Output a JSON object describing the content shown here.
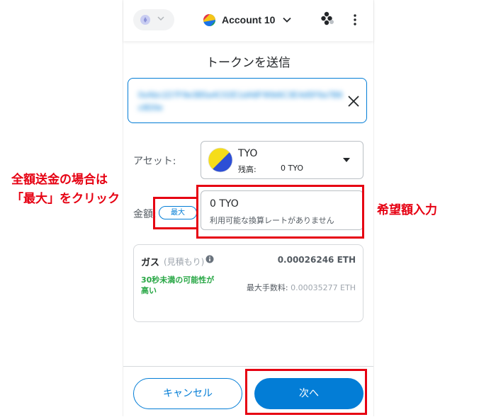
{
  "header": {
    "network_icon": "ethereum-icon",
    "account_name": "Account 10",
    "connection_icon": "connected-sites-icon",
    "menu_icon": "kebab-menu-icon"
  },
  "page": {
    "title": "トークンを送信"
  },
  "recipient": {
    "address_blurred": "0xAbc1D7F9e3B5a4C02E1dA8F90b6C3E4d5F6a7B8c9D0e",
    "clear_icon": "close-icon"
  },
  "asset": {
    "label": "アセット:",
    "symbol": "TYO",
    "balance_label": "残高:",
    "balance_value": "0 TYO"
  },
  "amount": {
    "label": "金額:",
    "max_label": "最大",
    "value": "0 TYO",
    "conversion_note": "利用可能な換算レートがありません"
  },
  "gas": {
    "title": "ガス",
    "estimate_label": "(見積もり)",
    "value": "0.00026246 ETH",
    "likelihood": "30秒未満の可能性が高い",
    "max_fee_label": "最大手数料:",
    "max_fee_value": "0.00035277 ETH"
  },
  "footer": {
    "cancel_label": "キャンセル",
    "next_label": "次へ"
  },
  "annotations": {
    "max_note_line1": "全額送金の場合は",
    "max_note_line2": "「最大」をクリック",
    "amount_note": "希望額入力"
  },
  "colors": {
    "accent": "#037dd6",
    "annotation_red": "#e60012",
    "success_green": "#28a745"
  }
}
